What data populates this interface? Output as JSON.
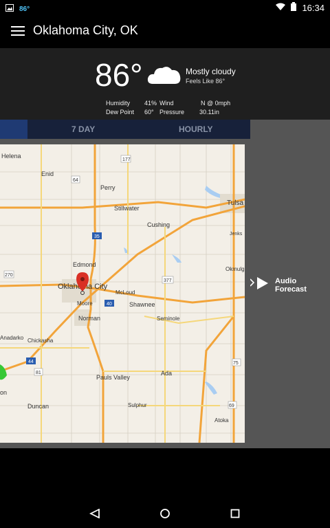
{
  "status_bar": {
    "temp_badge": "86°",
    "time": "16:34"
  },
  "app_bar": {
    "title": "Oklahoma City, OK"
  },
  "current": {
    "temperature": "86°",
    "condition": "Mostly cloudy",
    "feels_like": "Feels Like 86°",
    "humidity_label": "Humidity",
    "humidity_value": "41%",
    "wind_label": "Wind",
    "wind_value": "N @ 0mph",
    "dew_point_label": "Dew Point",
    "dew_point_value": "60°",
    "pressure_label": "Pressure",
    "pressure_value": "30.11in"
  },
  "tabs": [
    {
      "label": "7 DAY"
    },
    {
      "label": "HOURLY"
    }
  ],
  "map": {
    "labels": {
      "helena": "Helena",
      "enid": "Enid",
      "perry": "Perry",
      "stillwater": "Stillwater",
      "tulsa": "Tulsa",
      "cushing": "Cushing",
      "jenks": "Jenks",
      "edmond": "Edmond",
      "okmulgee": "Okmulg",
      "okc": "Oklahoma City",
      "mcloud": "McLoud",
      "moore": "Moore",
      "shawnee": "Shawnee",
      "norman": "Norman",
      "seminole": "Seminole",
      "anadarko": "Anadarko",
      "chickasha": "Chickasha",
      "pauls_valley": "Pauls Valley",
      "ada": "Ada",
      "duncan": "Duncan",
      "sulphur": "Sulphur",
      "atoka": "Atoka",
      "lawton_partial": "on"
    },
    "shields": {
      "s177": "177",
      "s64": "64",
      "s35": "35",
      "s270": "270",
      "s377": "377",
      "s40": "40",
      "s44": "44",
      "s81": "81",
      "s69": "69",
      "s75": "75"
    }
  },
  "audio_forecast": {
    "label": "Audio Forecast"
  },
  "nav": {
    "back": "back",
    "home": "home",
    "recents": "recents"
  }
}
